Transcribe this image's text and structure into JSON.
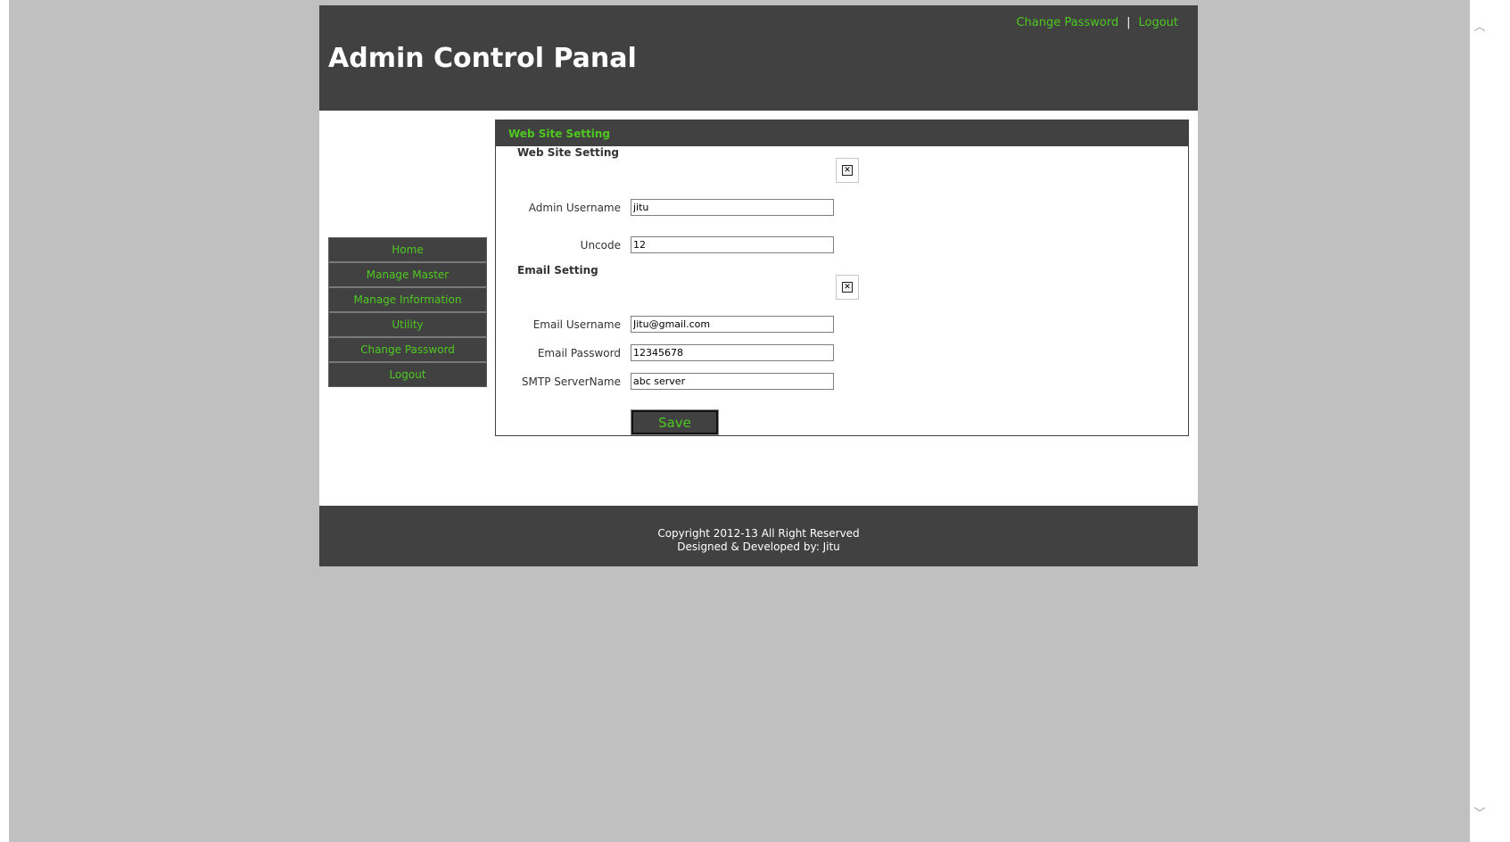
{
  "header": {
    "title": "Admin Control Panal",
    "links": {
      "change_password": "Change Password",
      "separator": "|",
      "logout": "Logout"
    }
  },
  "sidebar": {
    "items": [
      {
        "label": "Home"
      },
      {
        "label": "Manage Master"
      },
      {
        "label": "Manage Information"
      },
      {
        "label": "Utility"
      },
      {
        "label": "Change Password"
      },
      {
        "label": "Logout"
      }
    ]
  },
  "panel": {
    "header": "Web Site Setting",
    "website_section_title": "Web Site Setting",
    "email_section_title": "Email Setting",
    "fields": {
      "admin_username": {
        "label": "Admin Username",
        "value": "jitu"
      },
      "uncode": {
        "label": "Uncode",
        "value": "12"
      },
      "email_username": {
        "label": "Email Username",
        "value": "Jitu@gmail.com"
      },
      "email_password": {
        "label": "Email Password",
        "value": "12345678"
      },
      "smtp_servername": {
        "label": "SMTP ServerName",
        "value": "abc server"
      }
    },
    "save_label": "Save"
  },
  "footer": {
    "copyright": "Copyright 2012-13 All Right Reserved",
    "credits": "Designed & Developed by: Jitu"
  },
  "colors": {
    "accent_green": "#4ec820",
    "dark_bar": "#414141",
    "page_background": "#c0c0c0"
  },
  "icons": {
    "broken_image": "broken-image-icon",
    "scroll_up": "chevron-up-icon",
    "scroll_down": "chevron-down-icon"
  }
}
